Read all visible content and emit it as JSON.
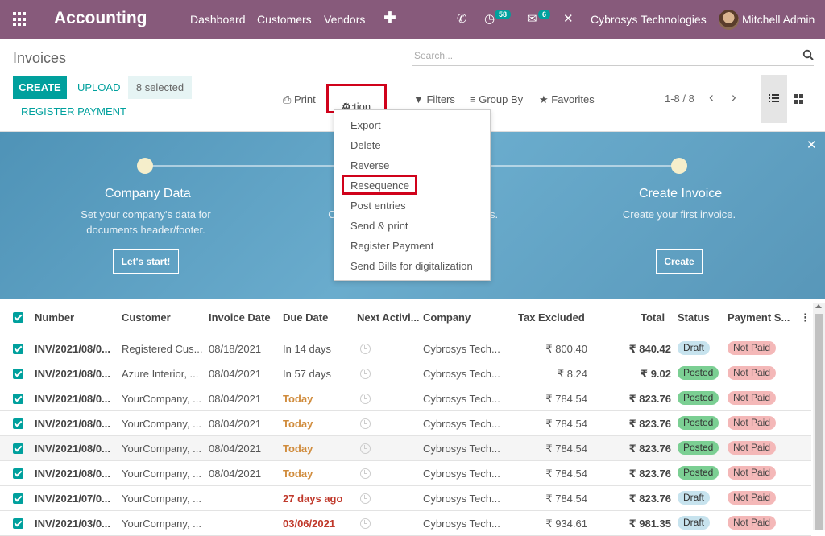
{
  "topbar": {
    "app": "Accounting",
    "nav": [
      "Dashboard",
      "Customers",
      "Vendors"
    ],
    "activity_count": "58",
    "message_count": "6",
    "company": "Cybrosys Technologies",
    "user": "Mitchell Admin"
  },
  "control": {
    "title": "Invoices",
    "search_placeholder": "Search...",
    "create": "CREATE",
    "upload": "UPLOAD",
    "selected": "8 selected",
    "register_payment": "REGISTER PAYMENT",
    "print": "Print",
    "action": "Action",
    "filters": "Filters",
    "group_by": "Group By",
    "favorites": "Favorites",
    "pager": "1-8 / 8"
  },
  "action_menu": [
    "Export",
    "Delete",
    "Reverse",
    "Resequence",
    "Post entries",
    "Send & print",
    "Register Payment",
    "Send Bills for digitalization"
  ],
  "banner": {
    "step1": {
      "title": "Company Data",
      "text1": "Set your company's data for",
      "text2": "documents header/footer.",
      "button": "Let's start!"
    },
    "step2": {
      "partial_left": "C",
      "partial_right": "s."
    },
    "step3": {
      "title": "Create Invoice",
      "text1": "Create your first invoice.",
      "button": "Create"
    }
  },
  "table": {
    "headers": [
      "Number",
      "Customer",
      "Invoice Date",
      "Due Date",
      "Next Activi...",
      "Company",
      "Tax Excluded",
      "Total",
      "Status",
      "Payment S..."
    ],
    "rows": [
      {
        "number": "INV/2021/08/0...",
        "customer": "Registered Cus...",
        "invoice_date": "08/18/2021",
        "due": "In 14 days",
        "company": "Cybrosys Tech...",
        "tax_excl": "₹ 800.40",
        "total": "₹ 840.42",
        "status": "Draft",
        "payment": "Not Paid"
      },
      {
        "number": "INV/2021/08/0...",
        "customer": "Azure Interior, ...",
        "invoice_date": "08/04/2021",
        "due": "In 57 days",
        "company": "Cybrosys Tech...",
        "tax_excl": "₹ 8.24",
        "total": "₹ 9.02",
        "status": "Posted",
        "payment": "Not Paid"
      },
      {
        "number": "INV/2021/08/0...",
        "customer": "YourCompany, ...",
        "invoice_date": "08/04/2021",
        "due": "Today",
        "company": "Cybrosys Tech...",
        "tax_excl": "₹ 784.54",
        "total": "₹ 823.76",
        "status": "Posted",
        "payment": "Not Paid"
      },
      {
        "number": "INV/2021/08/0...",
        "customer": "YourCompany, ...",
        "invoice_date": "08/04/2021",
        "due": "Today",
        "company": "Cybrosys Tech...",
        "tax_excl": "₹ 784.54",
        "total": "₹ 823.76",
        "status": "Posted",
        "payment": "Not Paid"
      },
      {
        "number": "INV/2021/08/0...",
        "customer": "YourCompany, ...",
        "invoice_date": "08/04/2021",
        "due": "Today",
        "company": "Cybrosys Tech...",
        "tax_excl": "₹ 784.54",
        "total": "₹ 823.76",
        "status": "Posted",
        "payment": "Not Paid"
      },
      {
        "number": "INV/2021/08/0...",
        "customer": "YourCompany, ...",
        "invoice_date": "08/04/2021",
        "due": "Today",
        "company": "Cybrosys Tech...",
        "tax_excl": "₹ 784.54",
        "total": "₹ 823.76",
        "status": "Posted",
        "payment": "Not Paid"
      },
      {
        "number": "INV/2021/07/0...",
        "customer": "YourCompany, ...",
        "invoice_date": "",
        "due": "27 days ago",
        "company": "Cybrosys Tech...",
        "tax_excl": "₹ 784.54",
        "total": "₹ 823.76",
        "status": "Draft",
        "payment": "Not Paid"
      },
      {
        "number": "INV/2021/03/0...",
        "customer": "YourCompany, ...",
        "invoice_date": "",
        "due": "03/06/2021",
        "company": "Cybrosys Tech...",
        "tax_excl": "₹ 934.61",
        "total": "₹ 981.35",
        "status": "Draft",
        "payment": "Not Paid"
      }
    ]
  },
  "colors": {
    "brand": "#875a7b",
    "accent": "#00a09d",
    "highlight": "#d0021b",
    "today": "#d08b3b",
    "overdue": "#c0392b",
    "draft": "#c7e3ee",
    "posted": "#7bcf93",
    "notpaid": "#f4b8b8"
  }
}
